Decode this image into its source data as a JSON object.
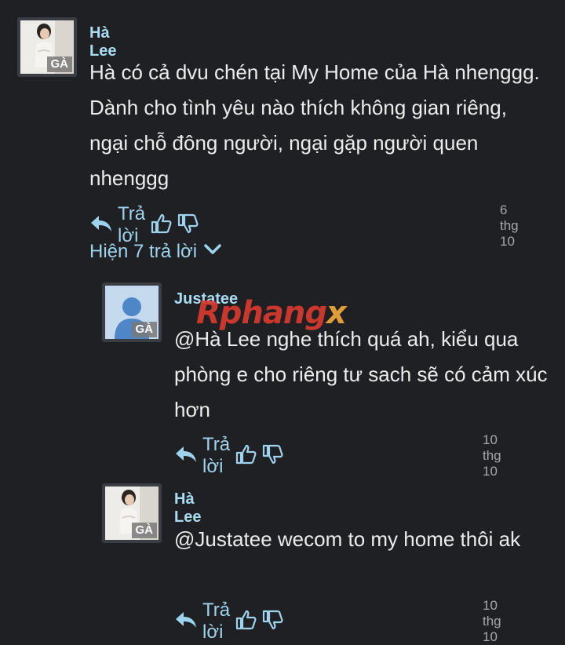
{
  "comments": [
    {
      "author": "Hà Lee",
      "badge": "GÀ",
      "text": "Hà có cả dvu chén tại My Home của Hà nhenggg. Dành cho tình yêu nào thích không gian riêng, ngại chỗ đông người, ngại gặp người quen nhenggg",
      "reply_label": "Trả lời",
      "date": "6 thg 10"
    },
    {
      "author": "Justatee",
      "badge": "GÀ",
      "text": "@Hà Lee nghe thích quá ah, kiểu qua phòng e cho riêng tư sach sẽ có cảm xúc hơn",
      "reply_label": "Trả lời",
      "date": "10 thg 10"
    },
    {
      "author": "Hà Lee",
      "badge": "GÀ",
      "text": "@Justatee wecom to my home thôi ak",
      "reply_label": "Trả lời",
      "date": "10 thg 10"
    }
  ],
  "show_replies": "Hiện 7 trả lời",
  "watermark": {
    "main": "Rphang",
    "x": "x"
  },
  "colors": {
    "background": "#1f2023",
    "link": "#9ed3ee",
    "author": "#a9dcf2",
    "date": "#a7a7aa"
  },
  "icons": [
    "reply-arrow-icon",
    "thumbs-up-icon",
    "thumbs-down-icon",
    "chevron-down-icon"
  ]
}
